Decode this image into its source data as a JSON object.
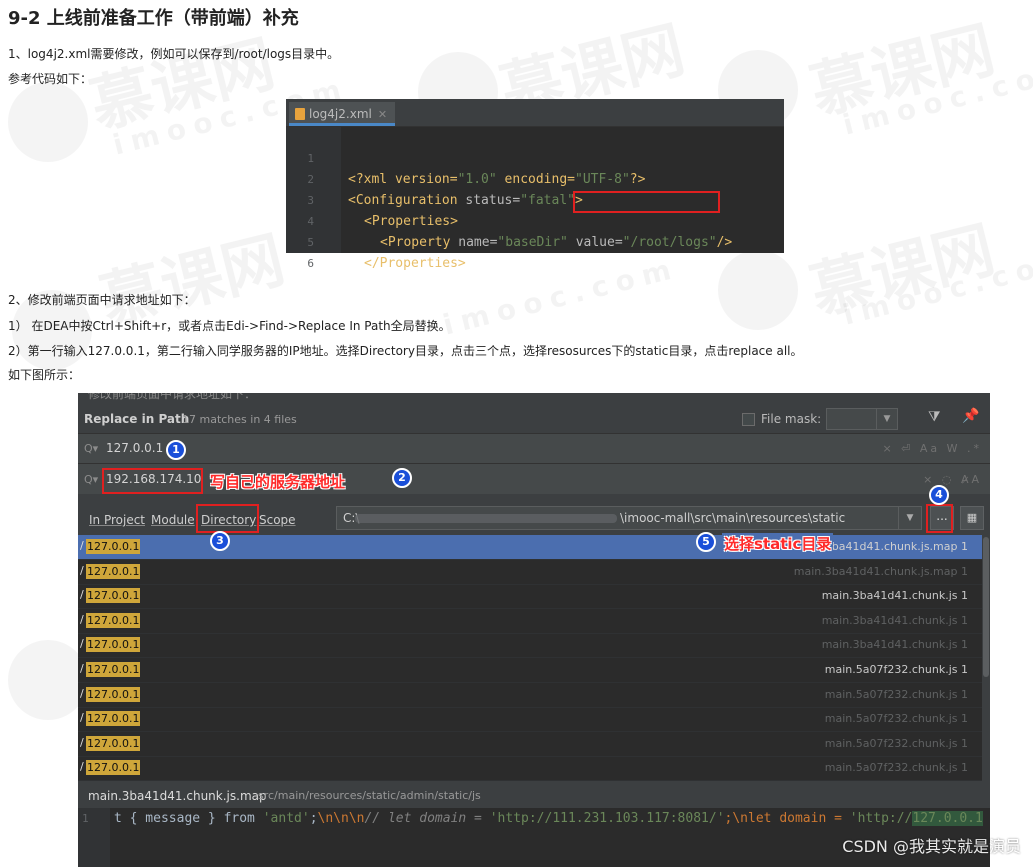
{
  "title": "9-2 上线前准备工作（带前端）补充",
  "paras": {
    "p1": "1、log4j2.xml需要修改，例如可以保存到/root/logs目录中。",
    "p2": "参考代码如下：",
    "p3": "2、修改前端页面中请求地址如下：",
    "p4": "1） 在DEA中按Ctrl+Shift+r，或者点击Edi->Find->Replace In Path全局替换。",
    "p5": "2）第一行输入127.0.0.1，第二行输入同学服务器的IP地址。选择Directory目录，点击三个点，选择resosurces下的static目录，点击replace all。",
    "p6": "如下图所示："
  },
  "editor": {
    "tab_label": "log4j2.xml",
    "line_numbers": [
      "1",
      "2",
      "3",
      "4",
      "5",
      "6"
    ],
    "l1_a": "<?xml version=",
    "l1_b": "\"1.0\"",
    "l1_c": " encoding=",
    "l1_d": "\"UTF-8\"",
    "l1_e": "?>",
    "l2_a": "<Configuration",
    "l2_b": " status=",
    "l2_c": "\"fatal\"",
    "l2_d": ">",
    "l3": "<Properties>",
    "l4_a": "<Property",
    "l4_b": " name=",
    "l4_c": "\"baseDir\"",
    "l4_d": " value=",
    "l4_e": "\"/root/logs\"",
    "l4_f": "/>",
    "l5": "</Properties>"
  },
  "ide": {
    "bleed_text": "修改前端页面中请求地址如下：",
    "header_title": "Replace in Path",
    "header_matches": "17 matches in 4 files",
    "file_mask_label": "File mask:",
    "search_value": "127.0.0.1",
    "replace_value": "192.168.174.10",
    "search_opts": "× ⏎ Aa W .*",
    "replace_opts": "× ◌ A̷A",
    "scope_tabs": [
      "In Project",
      "Module",
      "Directory",
      "Scope"
    ],
    "dir_prefix": "C:\\",
    "dir_suffix": "\\imooc-mall\\src\\main\\resources\\static",
    "dots_label": "...",
    "match_text": "127.0.0.1",
    "results": [
      {
        "file": "main.3ba41d41.chunk.js.map 1",
        "color": "#d0d0d0",
        "selected": true
      },
      {
        "file": "main.3ba41d41.chunk.js.map 1",
        "color": "#5f6162",
        "selected": false
      },
      {
        "file": "main.3ba41d41.chunk.js 1",
        "color": "#c8c8c8",
        "selected": false
      },
      {
        "file": "main.3ba41d41.chunk.js 1",
        "color": "#5f6162",
        "selected": false
      },
      {
        "file": "main.3ba41d41.chunk.js 1",
        "color": "#5f6162",
        "selected": false
      },
      {
        "file": "main.5a07f232.chunk.js 1",
        "color": "#c8c8c8",
        "selected": false
      },
      {
        "file": "main.5a07f232.chunk.js 1",
        "color": "#5f6162",
        "selected": false
      },
      {
        "file": "main.5a07f232.chunk.js 1",
        "color": "#5f6162",
        "selected": false
      },
      {
        "file": "main.5a07f232.chunk.js 1",
        "color": "#5f6162",
        "selected": false
      },
      {
        "file": "main.5a07f232.chunk.js 1",
        "color": "#5f6162",
        "selected": false
      }
    ],
    "path_file": "main.3ba41d41.chunk.js.map",
    "path_dir": "src/main/resources/static/admin/static/js",
    "preview_line": "1",
    "preview_a": "t { message } from ",
    "preview_b": "'antd'",
    "preview_c": ";",
    "preview_d": "\\n\\n\\n",
    "preview_e": "// let domain = ",
    "preview_f": "'http://111.231.103.117:8081/'",
    "preview_g": ";\\nlet domain = ",
    "preview_h": "'http://",
    "preview_i": "127.0.0.1"
  },
  "annotations": {
    "n1": "1",
    "n2": "2",
    "n3": "3",
    "n4": "4",
    "n5": "5",
    "note_server": "写自己的服务器地址",
    "note_static": "选择static目录"
  },
  "watermark": {
    "cn": "慕课网",
    "en": "imooc.com"
  },
  "csdn_mark": "CSDN @我其实就是演员"
}
